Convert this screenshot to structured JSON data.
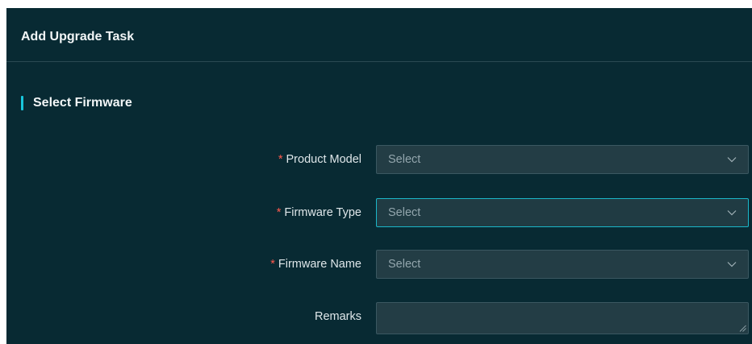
{
  "panel": {
    "title": "Add Upgrade Task"
  },
  "section": {
    "title": "Select Firmware"
  },
  "form": {
    "required_mark": "*",
    "fields": [
      {
        "label": "Product Model",
        "required": true,
        "placeholder": "Select",
        "type": "select",
        "focused": false
      },
      {
        "label": "Firmware Type",
        "required": true,
        "placeholder": "Select",
        "type": "select",
        "focused": true
      },
      {
        "label": "Firmware Name",
        "required": true,
        "placeholder": "Select",
        "type": "select",
        "focused": false
      },
      {
        "label": "Remarks",
        "required": false,
        "value": "",
        "type": "textarea"
      }
    ]
  },
  "icons": {
    "dropdown": "chevron-down-icon",
    "resize": "resize-handle-icon"
  },
  "colors": {
    "panel_background": "#082a33",
    "accent": "#18c6dc",
    "focus_border": "#1bb7c9",
    "required": "#ff5a4e",
    "field_background": "#233d45"
  }
}
